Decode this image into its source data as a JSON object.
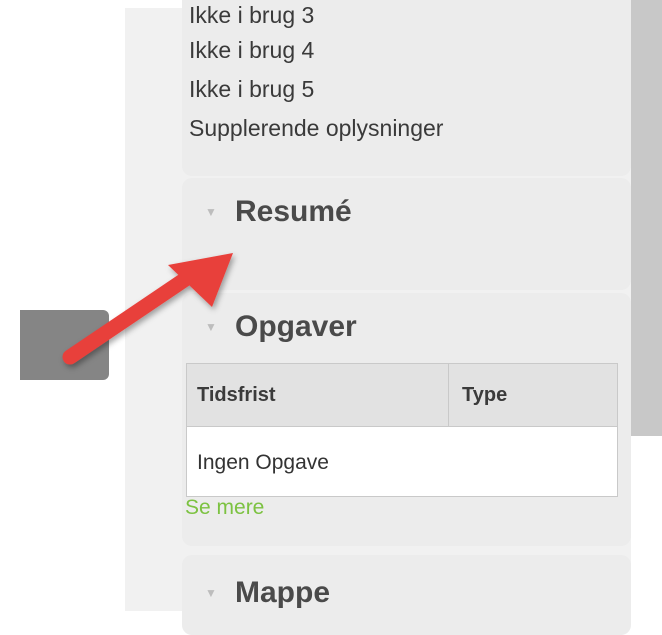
{
  "details_list": {
    "items": [
      "Ikke i brug 3",
      "Ikke i brug 4",
      "Ikke i brug 5",
      "Supplerende oplysninger"
    ]
  },
  "resume": {
    "title": "Resumé",
    "caret_icon": "triangle-down-icon"
  },
  "opgaver": {
    "title": "Opgaver",
    "caret_icon": "triangle-down-icon",
    "table": {
      "columns": [
        "Tidsfrist",
        "Type"
      ],
      "empty_text": "Ingen Opgave"
    },
    "see_more": "Se mere"
  },
  "mappe": {
    "title": "Mappe",
    "caret_icon": "triangle-down-icon"
  },
  "colors": {
    "link_green": "#7cc241",
    "annotation_arrow": "#e8403b"
  }
}
